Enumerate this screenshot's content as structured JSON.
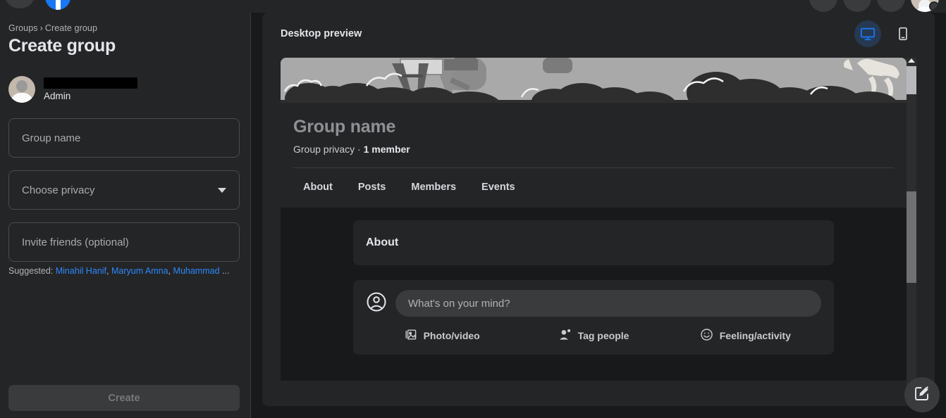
{
  "topbar": {
    "search_icon": "search-icon",
    "logo": "facebook-logo",
    "right_buttons": [
      "menu-grid-icon",
      "messenger-icon",
      "notifications-icon"
    ],
    "avatar": "user-avatar"
  },
  "sidebar": {
    "breadcrumb_root": "Groups",
    "breadcrumb_sep": "›",
    "breadcrumb_current": "Create group",
    "page_title": "Create group",
    "admin": {
      "name_redacted": "",
      "role_label": "Admin",
      "avatar_icon": "admin-avatar"
    },
    "fields": {
      "group_name_placeholder": "Group name",
      "privacy_placeholder": "Choose privacy",
      "privacy_caret_icon": "chevron-down-icon",
      "invite_placeholder": "Invite friends (optional)"
    },
    "suggested": {
      "label": "Suggested:",
      "names": [
        "Minahil Hanif",
        "Maryum Amna",
        "Muhammad"
      ],
      "ellipsis": "..."
    },
    "create_button": {
      "label": "Create",
      "disabled": true
    }
  },
  "preview": {
    "header_title": "Desktop preview",
    "device_toggle": {
      "desktop_icon": "desktop-monitor-icon",
      "mobile_icon": "mobile-phone-icon",
      "active": "desktop",
      "active_color": "#1877f2",
      "active_bg": "#263951"
    },
    "group": {
      "cover_photo": "illustration-cover-photo",
      "name": "Group name",
      "privacy_text": "Group privacy",
      "separator": "·",
      "member_count": "1 member",
      "tabs": [
        {
          "label": "About"
        },
        {
          "label": "Posts"
        },
        {
          "label": "Members"
        },
        {
          "label": "Events"
        }
      ],
      "about_card_title": "About",
      "composer": {
        "avatar_icon": "user-circle-icon",
        "placeholder": "What's on your mind?",
        "actions": [
          {
            "label": "Photo/video",
            "icon": "photo-video-icon"
          },
          {
            "label": "Tag people",
            "icon": "tag-people-icon"
          },
          {
            "label": "Feeling/activity",
            "icon": "feeling-activity-icon"
          }
        ]
      }
    },
    "scrollbar": {
      "up_arrow_icon": "scroll-up-arrow-icon"
    }
  },
  "fab": {
    "icon": "compose-pencil-icon"
  },
  "colors": {
    "page_bg": "#18191a",
    "panel_bg": "#242526",
    "field_border": "#4a4b4d",
    "link_blue": "#2d88ff",
    "brand_blue": "#1877f2",
    "text_primary": "#e4e6eb",
    "text_secondary": "#b0b3b8",
    "disabled_text": "#76787b"
  }
}
